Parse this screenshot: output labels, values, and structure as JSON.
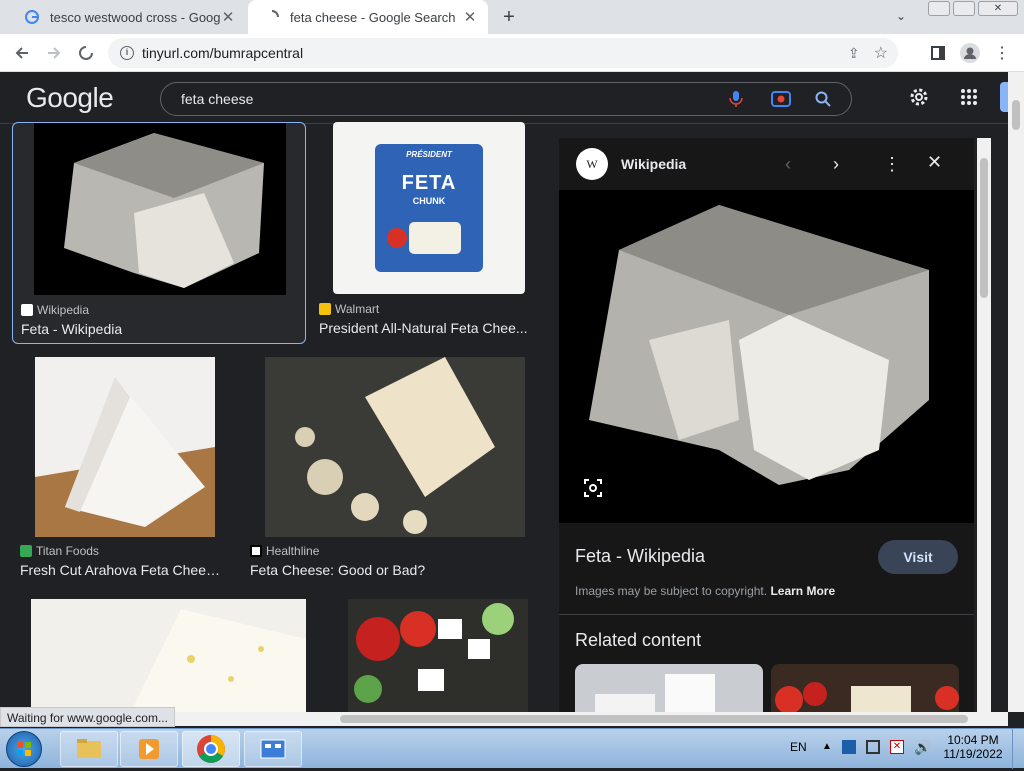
{
  "browser": {
    "tabs": [
      {
        "title": "tesco westwood cross - Google S",
        "active": false
      },
      {
        "title": "feta cheese - Google Search",
        "active": true
      }
    ],
    "url": "tinyurl.com/bumrapcentral",
    "status": "Waiting for www.google.com..."
  },
  "google": {
    "logo": "Google",
    "query": "feta cheese"
  },
  "results": [
    {
      "source": "Wikipedia",
      "title": "Feta - Wikipedia"
    },
    {
      "source": "Walmart",
      "title": "President All-Natural Feta Chee..."
    },
    {
      "source": "Titan Foods",
      "title": "Fresh Cut Arahova Feta Chees..."
    },
    {
      "source": "Healthline",
      "title": "Feta Cheese: Good or Bad?"
    }
  ],
  "president_label": {
    "brand": "PRÉSIDENT",
    "name": "FETA",
    "sub": "CHUNK"
  },
  "panel": {
    "source": "Wikipedia",
    "source_initial": "W",
    "title": "Feta - Wikipedia",
    "visit": "Visit",
    "copyright": "Images may be subject to copyright.",
    "learn_more": "Learn More",
    "related": "Related content"
  },
  "taskbar": {
    "lang": "EN",
    "time": "10:04 PM",
    "date": "11/19/2022"
  },
  "colors": {
    "accent": "#8ab4f8",
    "selected_border": "#8ab4f8"
  }
}
